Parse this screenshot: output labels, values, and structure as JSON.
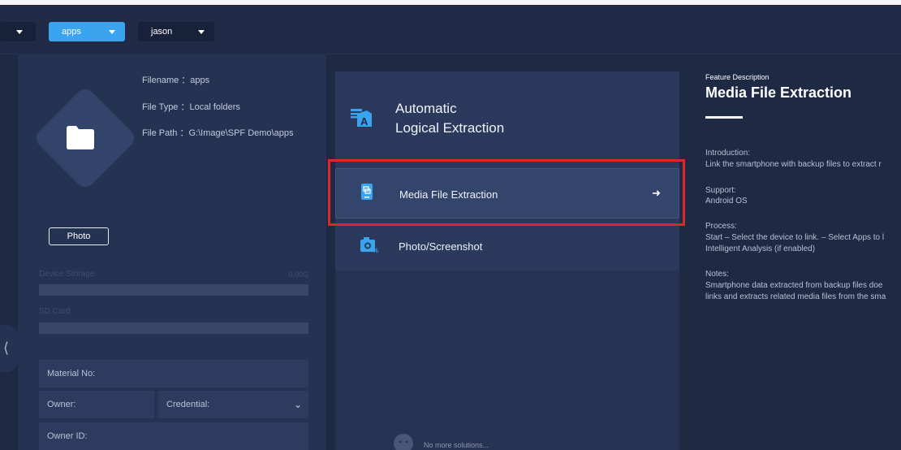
{
  "topbar": {
    "dropdowns": [
      {
        "label": ""
      },
      {
        "label": "apps"
      },
      {
        "label": "jason"
      }
    ]
  },
  "left": {
    "filename": "Filename ：apps",
    "filetype": "File Type ：Local folders",
    "filepath": "File Path ：G:\\Image\\SPF Demo\\apps",
    "photo_button": "Photo",
    "device_storage_label": "Device Storage",
    "device_storage_value": "0.00G",
    "sd_card_label": "SD Card",
    "material_no": "Material No:",
    "owner": "Owner:",
    "credential": "Credential:",
    "owner_id": "Owner ID:"
  },
  "middle": {
    "title_line1": "Automatic",
    "title_line2": "Logical Extraction",
    "options": [
      {
        "label": "Media File Extraction"
      },
      {
        "label": "Photo/Screenshot"
      }
    ],
    "no_more": "No more solutions..."
  },
  "right": {
    "header": "Feature Description",
    "title": "Media File Extraction",
    "intro_label": "Introduction:",
    "intro_text": "Link the smartphone with backup files to extract r",
    "support_label": "Support:",
    "support_text": "Android OS",
    "process_label": "Process:",
    "process_line1": "Start – Select the device to link. – Select Apps to l",
    "process_line2": "Intelligent Analysis (if enabled)",
    "notes_label": "Notes:",
    "notes_line1": "Smartphone data extracted from backup files doe",
    "notes_line2": "links and extracts related media files from the sma"
  },
  "colors": {
    "accent": "#3aa4ef",
    "highlight": "#e0262a",
    "background": "#1e2944"
  }
}
